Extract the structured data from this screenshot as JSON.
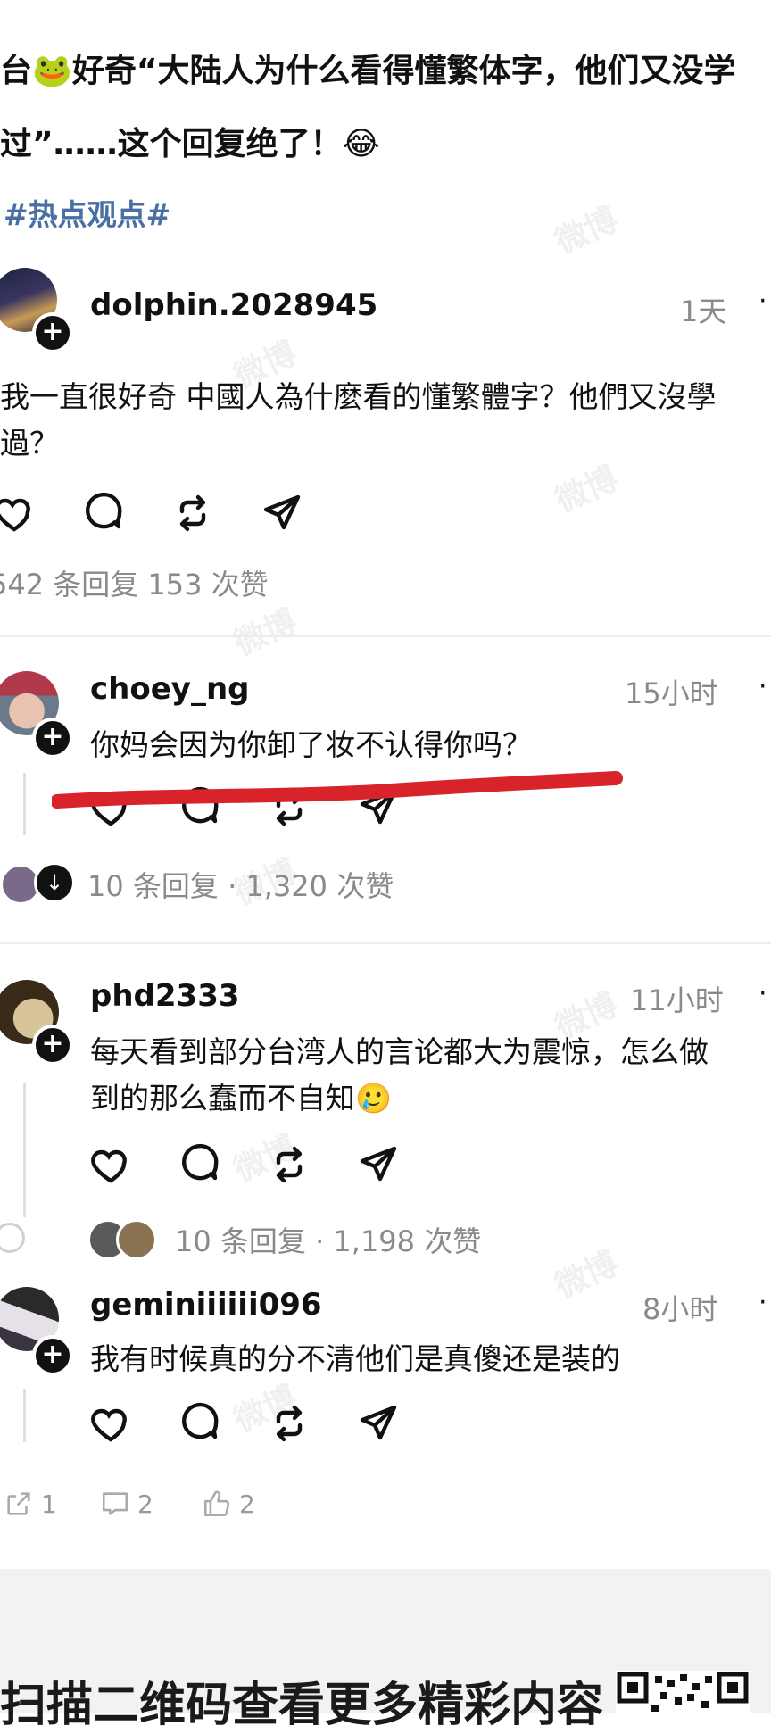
{
  "post": {
    "title_line1": "台🐸好奇“大陆人为什么看得懂繁体字，他们又没学",
    "title_line2": "过”……这个回复绝了！😂",
    "hashtag": "#热点观点#"
  },
  "watermark": "微博",
  "comments": [
    {
      "username": "dolphin.2028945",
      "time": "1天",
      "text_line1": "我一直很好奇  中國人為什麼看的懂繁體字？他們又沒學",
      "text_line2": "過？",
      "stats": "542 条回复 153 次赞",
      "avatar": "city-night-photo"
    },
    {
      "username": "choey_ng",
      "time": "15小时",
      "text_line1": "你妈会因为你卸了妆不认得你吗？",
      "stats": "10 条回复 · 1,320 次赞",
      "avatar": "person-red-hat"
    },
    {
      "username": "phd2333",
      "time": "11小时",
      "text_line1": "每天看到部分台湾人的言论都大为震惊，怎么做",
      "text_line2": "到的那么蠢而不自知🥲",
      "stats": "10 条回复 · 1,198 次赞",
      "avatar": "cat-photo"
    },
    {
      "username": "geminiiiiii096",
      "time": "8小时",
      "text_line1": "我有时候真的分不清他们是真傻还是装的",
      "avatar": "anime-avatar"
    }
  ],
  "icons": [
    "heart-icon",
    "comment-icon",
    "repost-icon",
    "share-icon",
    "more-icon"
  ],
  "footer": {
    "share_count": "1",
    "comment_count": "2",
    "like_count": "2"
  },
  "qr_banner": "扫描二维码查看更多精彩内容",
  "colors": {
    "hashtag": "#4a6fa5",
    "annotation": "#d9232a"
  }
}
